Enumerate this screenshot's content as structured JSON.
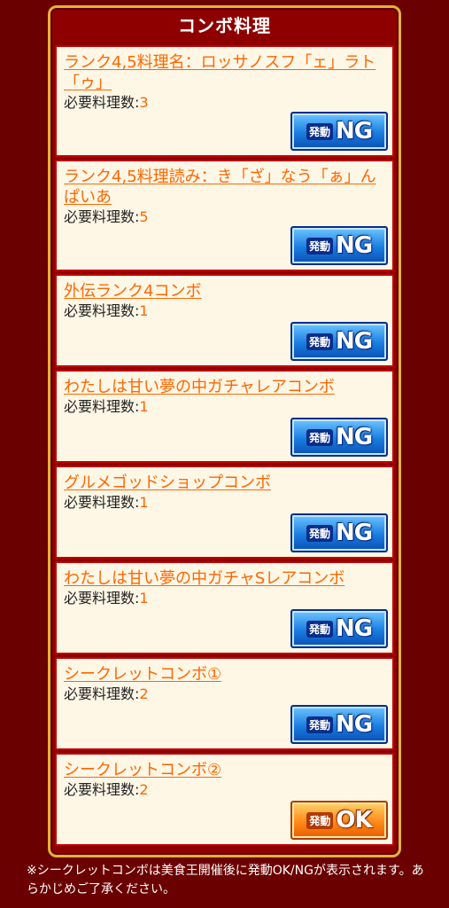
{
  "panel": {
    "title": "コンボ料理"
  },
  "items": [
    {
      "name": "ランク4,5料理名：ロッサノスフ「ェ」ラト「ゥ」",
      "req_label": "必要料理数:",
      "req": "3",
      "status": "NG",
      "status_prefix": "発動"
    },
    {
      "name": "ランク4,5料理読み：き「ざ」なう「ぁ」んぱいあ",
      "req_label": "必要料理数:",
      "req": "5",
      "status": "NG",
      "status_prefix": "発動"
    },
    {
      "name": "外伝ランク4コンボ",
      "req_label": "必要料理数:",
      "req": "1",
      "status": "NG",
      "status_prefix": "発動"
    },
    {
      "name": "わたしは甘い夢の中ガチャレアコンボ",
      "req_label": "必要料理数:",
      "req": "1",
      "status": "NG",
      "status_prefix": "発動"
    },
    {
      "name": "グルメゴッドショップコンボ",
      "req_label": "必要料理数:",
      "req": "1",
      "status": "NG",
      "status_prefix": "発動"
    },
    {
      "name": "わたしは甘い夢の中ガチャSレアコンボ",
      "req_label": "必要料理数:",
      "req": "1",
      "status": "NG",
      "status_prefix": "発動"
    },
    {
      "name": "シークレットコンボ①",
      "req_label": "必要料理数:",
      "req": "2",
      "status": "NG",
      "status_prefix": "発動"
    },
    {
      "name": "シークレットコンボ②",
      "req_label": "必要料理数:",
      "req": "2",
      "status": "OK",
      "status_prefix": "発動"
    }
  ],
  "footer_note": "※シークレットコンボは美食王開催後に発動OK/NGが表示されます。あらかじめご了承ください。",
  "colors": {
    "ng_badge": "#1a7de0",
    "ok_badge": "#ff8a1a",
    "link": "#ff6600",
    "frame": "#c00000"
  }
}
